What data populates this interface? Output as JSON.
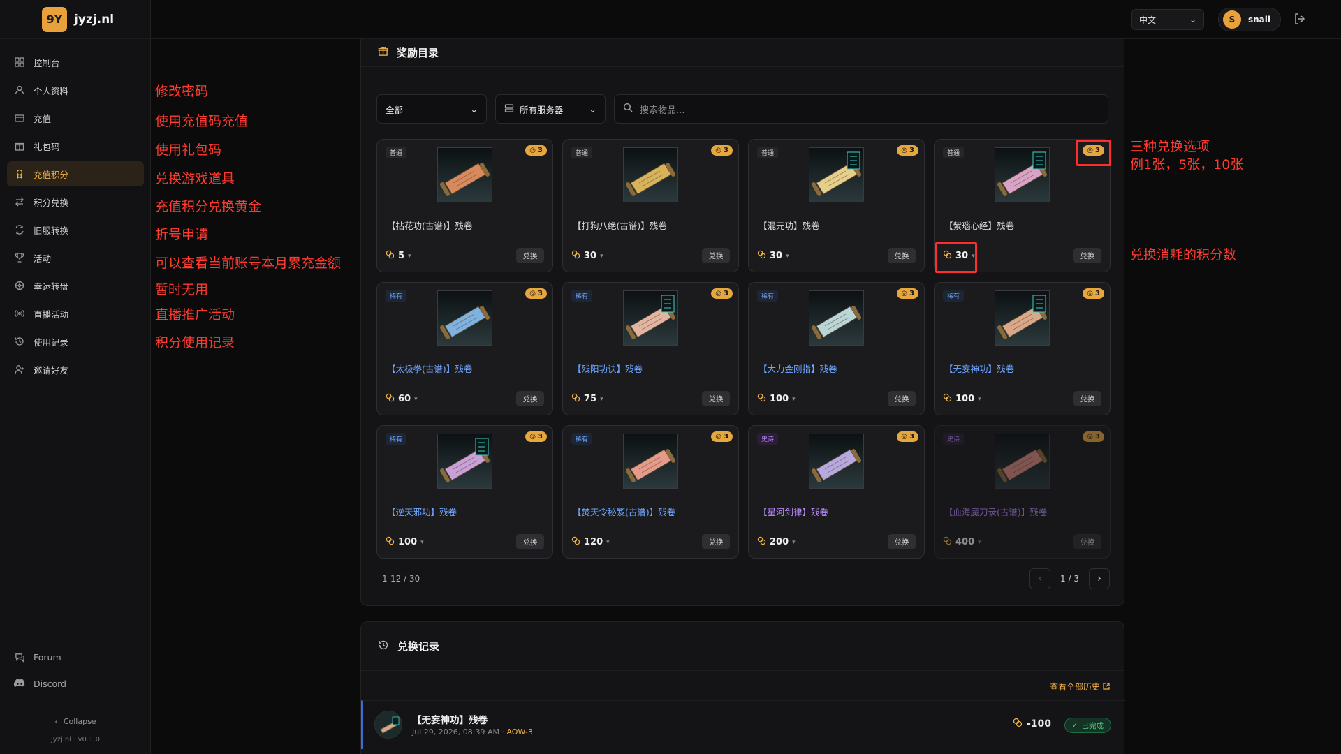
{
  "brand": {
    "logo_text": "9Y",
    "name": "jyzj.nl"
  },
  "sidebar": {
    "items": [
      {
        "label": "控制台",
        "icon": "dashboard-icon"
      },
      {
        "label": "个人资料",
        "icon": "user-icon"
      },
      {
        "label": "充值",
        "icon": "wallet-icon"
      },
      {
        "label": "礼包码",
        "icon": "gift-icon"
      },
      {
        "label": "充值积分",
        "icon": "coin-icon",
        "active": true
      },
      {
        "label": "积分兑换",
        "icon": "swap-icon"
      },
      {
        "label": "旧服转换",
        "icon": "convert-icon"
      },
      {
        "label": "活动",
        "icon": "trophy-icon"
      },
      {
        "label": "幸运转盘",
        "icon": "wheel-icon"
      },
      {
        "label": "直播活动",
        "icon": "broadcast-icon"
      },
      {
        "label": "使用记录",
        "icon": "history-icon"
      },
      {
        "label": "邀请好友",
        "icon": "invite-icon"
      }
    ],
    "forum": "Forum",
    "discord": "Discord",
    "collapse": "Collapse",
    "version": "jyzj.nl · v0.1.0"
  },
  "header": {
    "language": "中文",
    "avatar_letter": "S",
    "username": "snail"
  },
  "annotations": {
    "left": [
      "修改密码",
      "使用充值码充值",
      "使用礼包码",
      "兑换游戏道具",
      "充值积分兑换黄金",
      "折号申请",
      "可以查看当前账号本月累充金额",
      "暂时无用",
      "直播推广活动",
      "积分使用记录"
    ],
    "right_top_1": "三种兑换选项",
    "right_top_2": "例1张，5张，10张",
    "right_mid": "兑换消耗的积分数"
  },
  "catalog": {
    "title": "奖励目录",
    "filter_category": "全部",
    "filter_server": "所有服务器",
    "search_placeholder": "搜索物品...",
    "redeem_label": "兑换",
    "items": [
      {
        "rarity": "普通",
        "tier": "common",
        "stock": "3",
        "name": "【拈花功(古谱)】残卷",
        "cost": "5",
        "color": "#d98a5c"
      },
      {
        "rarity": "普通",
        "tier": "common",
        "stock": "3",
        "name": "【打狗八绝(古谱)】残卷",
        "cost": "30",
        "color": "#d8b35a"
      },
      {
        "rarity": "普通",
        "tier": "common",
        "stock": "3",
        "name": "【混元功】残卷",
        "cost": "30",
        "color": "#e6cf8a"
      },
      {
        "rarity": "普通",
        "tier": "common",
        "stock": "3",
        "name": "【紫瑙心经】残卷",
        "cost": "30",
        "color": "#d9a2c7"
      },
      {
        "rarity": "稀有",
        "tier": "rare",
        "stock": "3",
        "name": "【太极拳(古谱)】残卷",
        "cost": "60",
        "color": "#7fb2e0"
      },
      {
        "rarity": "稀有",
        "tier": "rare",
        "stock": "3",
        "name": "【残阳功诀】残卷",
        "cost": "75",
        "color": "#e2b5a3"
      },
      {
        "rarity": "稀有",
        "tier": "rare",
        "stock": "3",
        "name": "【大力金刚指】残卷",
        "cost": "100",
        "color": "#b9d5d8"
      },
      {
        "rarity": "稀有",
        "tier": "rare",
        "stock": "3",
        "name": "【无妄神功】残卷",
        "cost": "100",
        "color": "#d9a888"
      },
      {
        "rarity": "稀有",
        "tier": "rare",
        "stock": "3",
        "name": "【逆天邪功】残卷",
        "cost": "100",
        "color": "#c9a0d8"
      },
      {
        "rarity": "稀有",
        "tier": "rare",
        "stock": "3",
        "name": "【焚天令秘笈(古谱)】残卷",
        "cost": "120",
        "color": "#e59a8a"
      },
      {
        "rarity": "史诗",
        "tier": "epic",
        "stock": "3",
        "name": "【星河剑律】残卷",
        "cost": "200",
        "color": "#b7a8e0"
      },
      {
        "rarity": "史诗",
        "tier": "epic",
        "stock": "3",
        "name": "【血海魔刀录(古谱)】残卷",
        "cost": "400",
        "color": "#d98a80",
        "disabled": true
      }
    ],
    "range": "1-12 / 30",
    "page": "1 / 3"
  },
  "history": {
    "title": "兑换记录",
    "view_all": "查看全部历史",
    "entry": {
      "name": "【无妄神功】残卷",
      "date": "Jul 29, 2026, 08:39 AM · ",
      "server": "AOW-3",
      "points": "-100",
      "status": "已完成"
    }
  }
}
